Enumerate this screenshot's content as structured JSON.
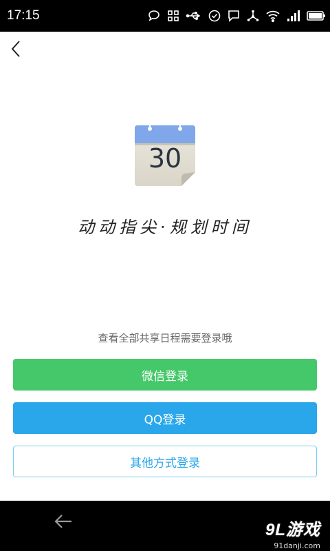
{
  "status_bar": {
    "time": "17:15"
  },
  "calendar": {
    "day": "30"
  },
  "slogan": "动动指尖·规划时间",
  "login": {
    "hint": "查看全部共享日程需要登录哦",
    "wechat_label": "微信登录",
    "qq_label": "QQ登录",
    "other_label": "其他方式登录"
  },
  "watermark": {
    "brand": "9L游戏",
    "site": "91danji.com"
  },
  "colors": {
    "wechat": "#45c86a",
    "qq": "#2aa7ea",
    "other_border": "#7ccdf2"
  }
}
